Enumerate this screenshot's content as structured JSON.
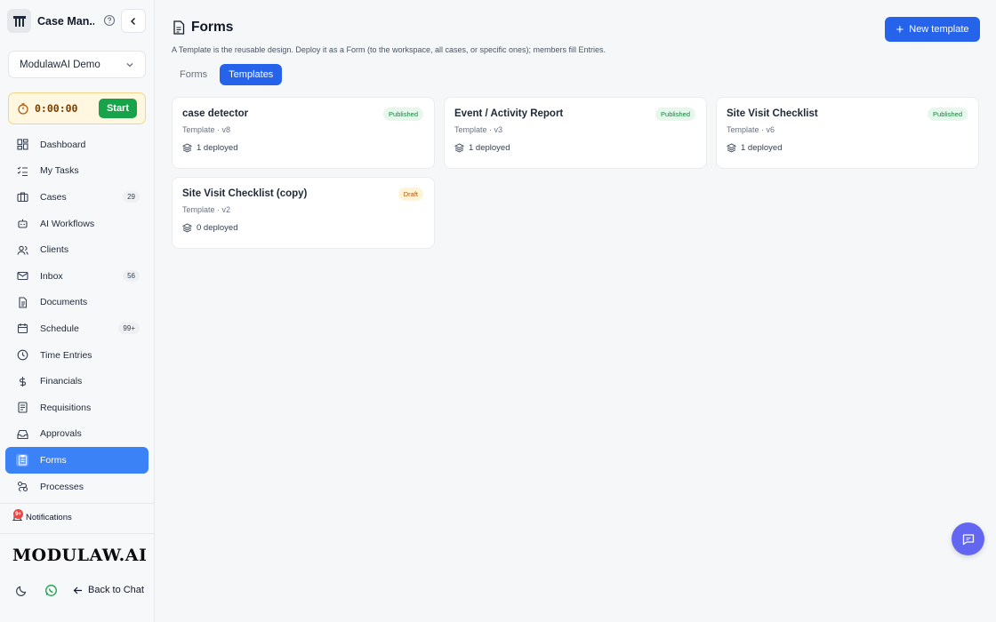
{
  "app": {
    "name": "Case Man..."
  },
  "workspace": {
    "selected": "ModulawAI Demo"
  },
  "timer": {
    "value": "0:00:00",
    "start_label": "Start"
  },
  "sidebar": {
    "items": [
      {
        "label": "Dashboard",
        "count": ""
      },
      {
        "label": "My Tasks",
        "count": ""
      },
      {
        "label": "Cases",
        "count": "29"
      },
      {
        "label": "AI Workflows",
        "count": ""
      },
      {
        "label": "Clients",
        "count": ""
      },
      {
        "label": "Inbox",
        "count": "56"
      },
      {
        "label": "Documents",
        "count": ""
      },
      {
        "label": "Schedule",
        "count": "99+"
      },
      {
        "label": "Time Entries",
        "count": ""
      },
      {
        "label": "Financials",
        "count": ""
      },
      {
        "label": "Requisitions",
        "count": ""
      },
      {
        "label": "Approvals",
        "count": ""
      },
      {
        "label": "Forms",
        "count": ""
      },
      {
        "label": "Processes",
        "count": ""
      }
    ],
    "active": "Forms",
    "notifications_label": "Notifications",
    "notifications_badge": "9+",
    "wordmark": "MODULAW.AI",
    "back_label": "Back to Chat"
  },
  "page": {
    "title": "Forms",
    "subtitle": "A Template is the reusable design. Deploy it as a Form (to the workspace, all cases, or specific ones); members fill Entries.",
    "new_button": "New template",
    "tabs": [
      {
        "label": "Forms",
        "active": false
      },
      {
        "label": "Templates",
        "active": true
      }
    ]
  },
  "templates": [
    {
      "title": "case detector",
      "meta": "Template · v8",
      "deployed": "1 deployed",
      "status": "Published"
    },
    {
      "title": "Event / Activity Report",
      "meta": "Template · v3",
      "deployed": "1 deployed",
      "status": "Published"
    },
    {
      "title": "Site Visit Checklist",
      "meta": "Template · v6",
      "deployed": "1 deployed",
      "status": "Published"
    },
    {
      "title": "Site Visit Checklist (copy)",
      "meta": "Template · v2",
      "deployed": "0 deployed",
      "status": "Draft"
    }
  ],
  "colors": {
    "accent": "#2563eb",
    "active_nav": "#3b82f6",
    "success": "#16a34a",
    "fab": "#6366f1"
  }
}
